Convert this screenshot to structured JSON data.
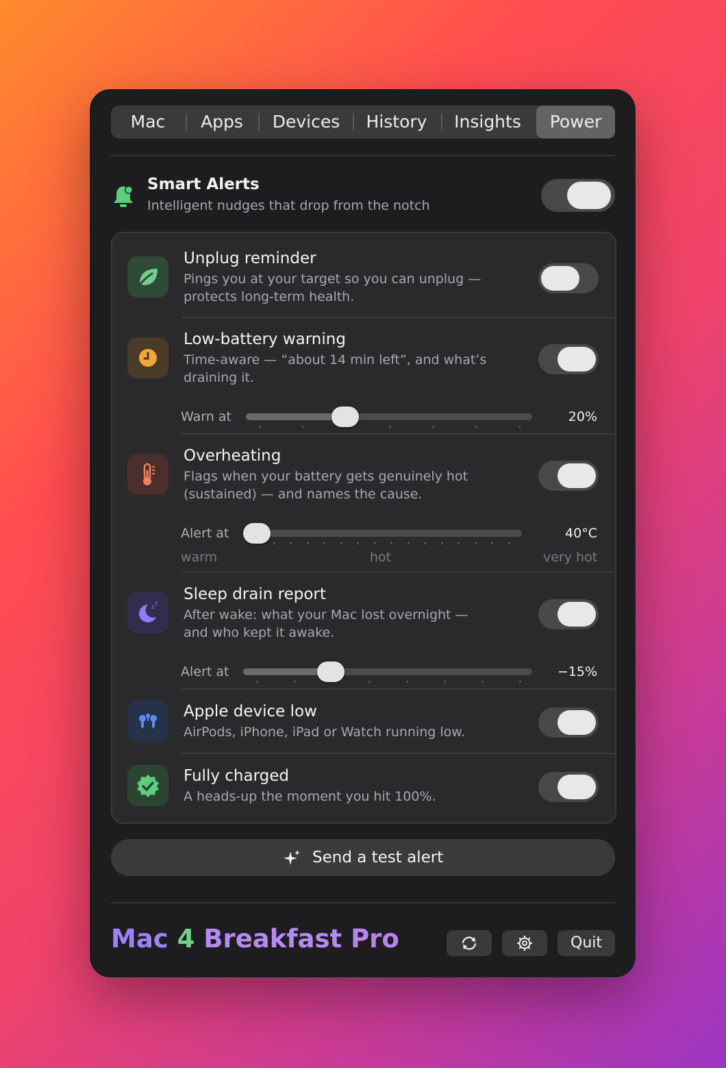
{
  "tabs": [
    {
      "label": "Mac"
    },
    {
      "label": "Apps"
    },
    {
      "label": "Devices"
    },
    {
      "label": "History"
    },
    {
      "label": "Insights"
    },
    {
      "label": "Power",
      "active": true
    }
  ],
  "smart_alerts": {
    "title": "Smart Alerts",
    "subtitle": "Intelligent nudges that drop from the notch",
    "enabled": true,
    "icon": "bell-icon"
  },
  "alerts": [
    {
      "title": "Unplug reminder",
      "desc_line1": "Pings you at your target so you can unplug —",
      "desc_line2": "protects long-term health.",
      "icon": "leaf-icon",
      "enabled": false
    },
    {
      "title": "Low-battery warning",
      "desc_line1": "Time-aware — “about 14 min left”, and what’s",
      "desc_line2": "draining it.",
      "icon": "clock-icon",
      "enabled": true,
      "slider": {
        "label": "Warn at",
        "value": "20%",
        "fraction": 0.35
      }
    },
    {
      "title": "Overheating",
      "desc_line1": "Flags when your battery gets genuinely hot",
      "desc_line2": "(sustained) — and names the cause.",
      "icon": "thermometer-icon",
      "enabled": true,
      "slider": {
        "label": "Alert at",
        "value": "40°C",
        "fraction": 0.0
      },
      "scale": [
        "warm",
        "hot",
        "very hot"
      ]
    },
    {
      "title": "Sleep drain report",
      "desc_line1": "After wake: what your Mac lost overnight —",
      "desc_line2": "and who kept it awake.",
      "icon": "moon-sleep-icon",
      "enabled": true,
      "slider": {
        "label": "Alert at",
        "value": "−15%",
        "fraction": 0.3
      }
    },
    {
      "title": "Apple device low",
      "desc_line1": "AirPods, iPhone, iPad or Watch running low.",
      "icon": "airpods-icon",
      "enabled": true
    },
    {
      "title": "Fully charged",
      "desc_line1": "A heads-up the moment you hit 100%.",
      "icon": "checkmark-seal-icon",
      "enabled": true
    }
  ],
  "test_button": {
    "label": "Send a test alert",
    "icon": "sparkles-icon"
  },
  "brand": {
    "mac": "Mac",
    "num": "4",
    "breakfast": "Breakfast",
    "pro": "Pro"
  },
  "footer": {
    "refresh_icon": "refresh-icon",
    "settings_icon": "gear-icon",
    "quit_label": "Quit"
  },
  "colors": {
    "accent_green": "#6fd08a",
    "accent_purple": "#b58af2",
    "panel_bg": "#1d1d1f",
    "list_bg": "#2a2a2c"
  }
}
